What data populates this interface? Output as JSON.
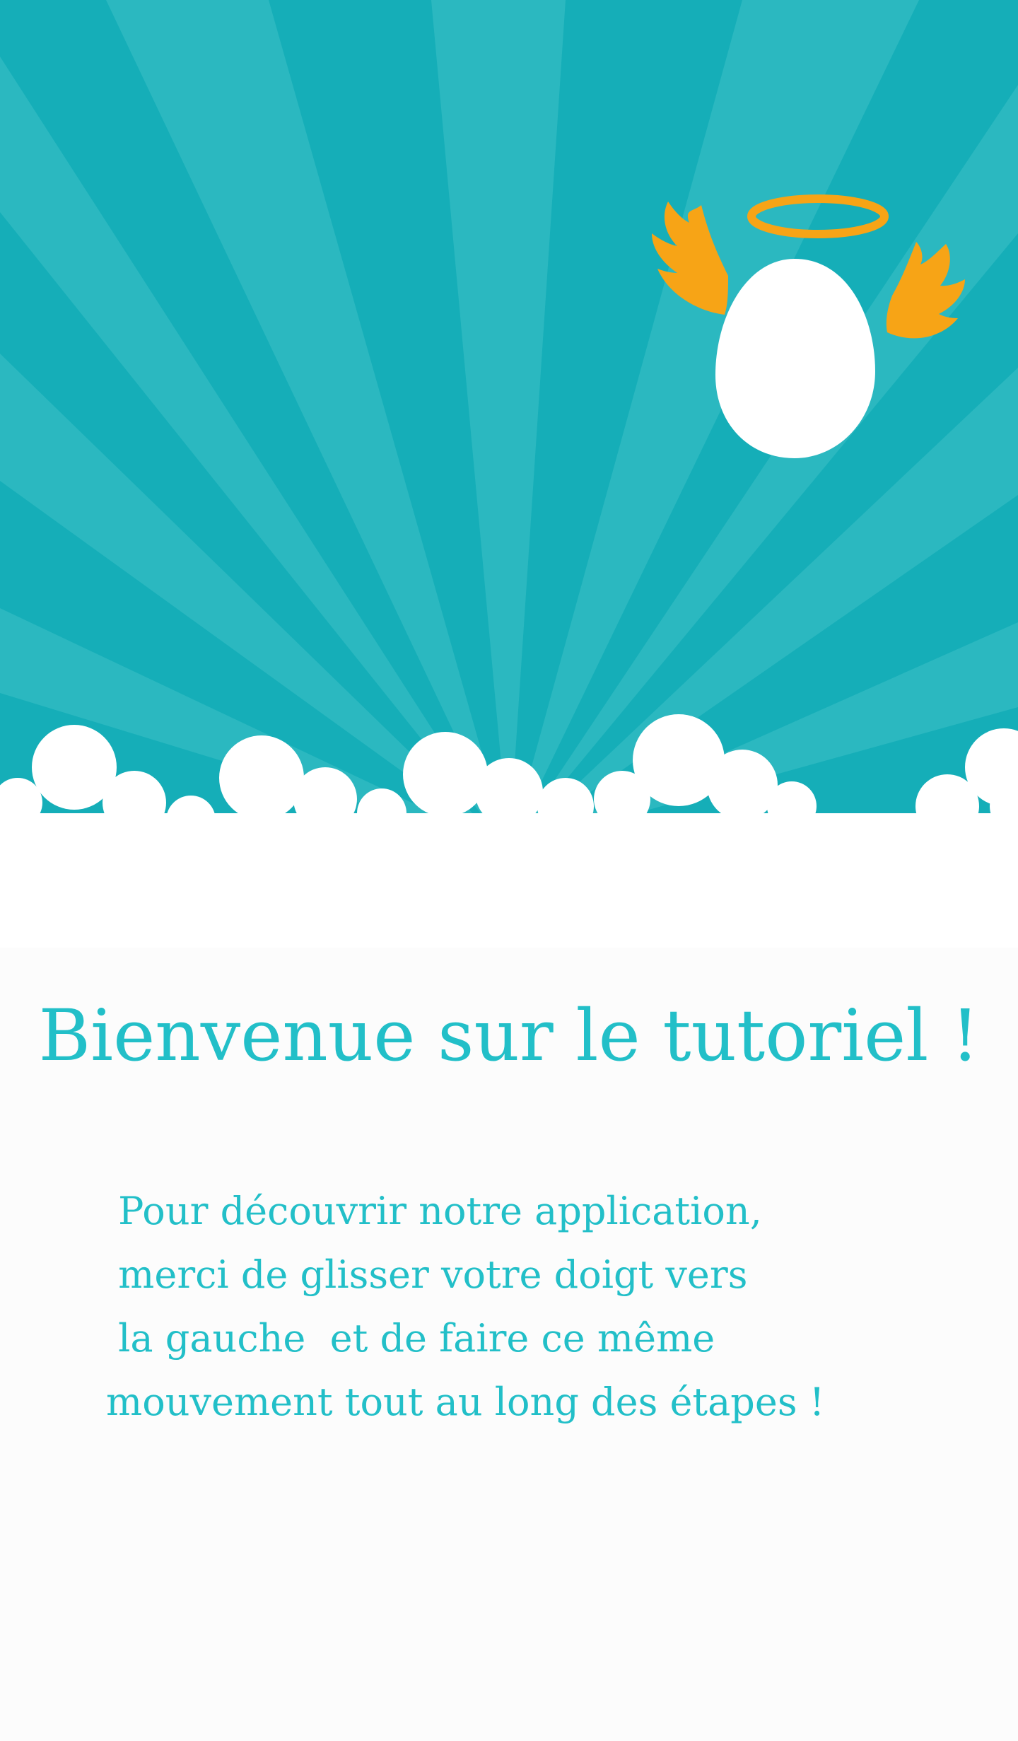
{
  "colors": {
    "sky": "#15aeb8",
    "ray": "#2bb8c0",
    "cloud": "#ffffff",
    "halo_wings": "#f7a416",
    "egg": "#ffffff",
    "text": "#22bfc8",
    "background": "#fcfcfc"
  },
  "illustration": {
    "icons": [
      "angel-egg-icon",
      "halo-icon",
      "left-wing-icon",
      "right-wing-icon",
      "clouds"
    ]
  },
  "title": "Bienvenue sur le tutoriel !",
  "instructions": {
    "lines": [
      " Pour découvrir notre application,",
      " merci de glisser votre doigt vers",
      " la gauche  et de faire ce même",
      "mouvement tout au long des étapes !"
    ]
  }
}
